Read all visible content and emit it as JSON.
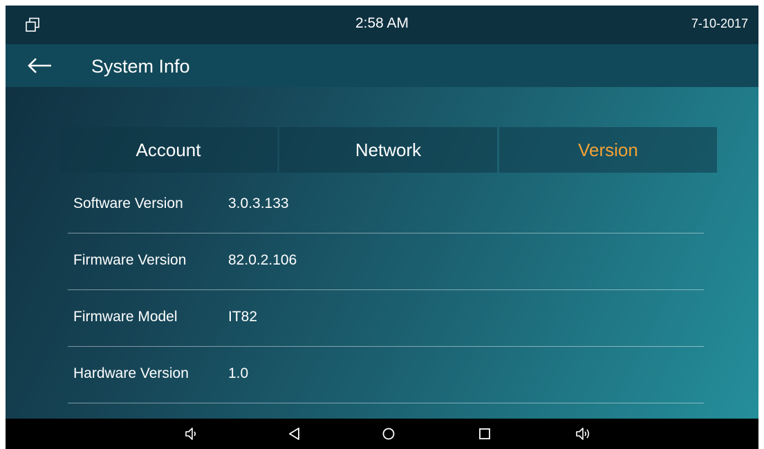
{
  "status_bar": {
    "time": "2:58 AM",
    "date": "7-10-2017"
  },
  "header": {
    "title": "System Info"
  },
  "tabs": [
    {
      "label": "Account",
      "active": false
    },
    {
      "label": "Network",
      "active": false
    },
    {
      "label": "Version",
      "active": true
    }
  ],
  "version_info": [
    {
      "label": "Software Version",
      "value": "3.0.3.133"
    },
    {
      "label": "Firmware Version",
      "value": "82.0.2.106"
    },
    {
      "label": "Firmware Model",
      "value": "IT82"
    },
    {
      "label": "Hardware Version",
      "value": "1.0"
    }
  ],
  "nav_bar": {
    "icons": [
      "volume-down-icon",
      "back-icon",
      "home-icon",
      "recents-icon",
      "volume-up-icon"
    ]
  },
  "colors": {
    "active_tab": "#f4a235",
    "status_bar_bg": "#0e3140",
    "title_bar_bg": "#12495a",
    "nav_bar_bg": "#000000"
  }
}
